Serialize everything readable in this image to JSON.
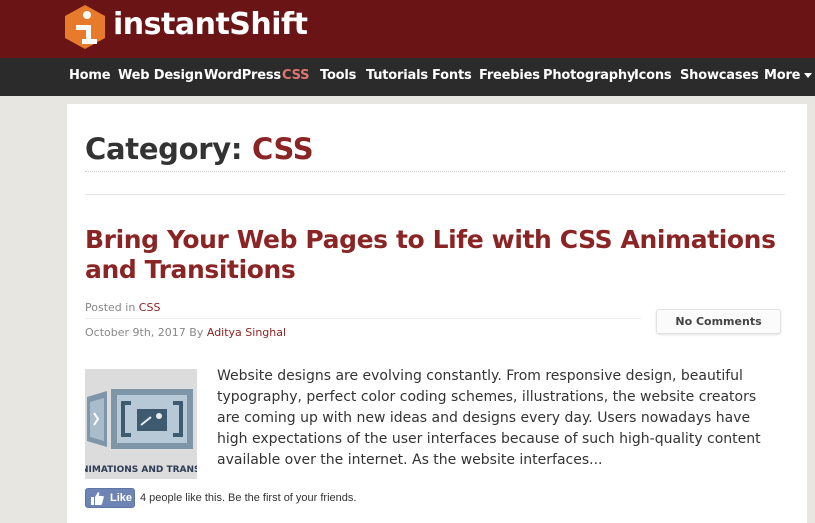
{
  "brand": {
    "name": "instantShift",
    "colors": {
      "topbar": "#6a1416",
      "nav": "#2b2b2b",
      "accent": "#8b2424",
      "logo_orange": "#e87a2c"
    }
  },
  "nav": {
    "items": [
      {
        "label": "Home"
      },
      {
        "label": "Web Design"
      },
      {
        "label": "WordPress"
      },
      {
        "label": "CSS",
        "active": true
      },
      {
        "label": "Tools"
      },
      {
        "label": "Tutorials"
      },
      {
        "label": "Fonts"
      },
      {
        "label": "Freebies"
      },
      {
        "label": "Photography"
      },
      {
        "label": "Icons"
      },
      {
        "label": "Showcases"
      },
      {
        "label": "More"
      }
    ],
    "more_icon": "chevron-down-icon"
  },
  "page": {
    "title_prefix": "Category:",
    "title_category": "CSS"
  },
  "post": {
    "title": "Bring Your Web Pages to Life with CSS Animations and Transitions",
    "posted_in_label": "Posted in",
    "category": "CSS",
    "date": "October 9th, 2017",
    "by_label": "By",
    "author": "Aditya Singhal",
    "comments": "No Comments",
    "thumbnail_caption": "NIMATIONS AND TRANSIT",
    "excerpt": "Website designs are evolving constantly. From responsive design, beautiful typography, perfect color coding schemes, illustrations, the website creators are coming up with new ideas and designs every day. Users nowadays have high expectations of the user interfaces because of such high-quality content available over the internet. As the website interfaces...",
    "like": {
      "button_label": "Like",
      "text": "4 people like this. Be the first of your friends.",
      "icon": "thumbs-up-icon"
    }
  }
}
